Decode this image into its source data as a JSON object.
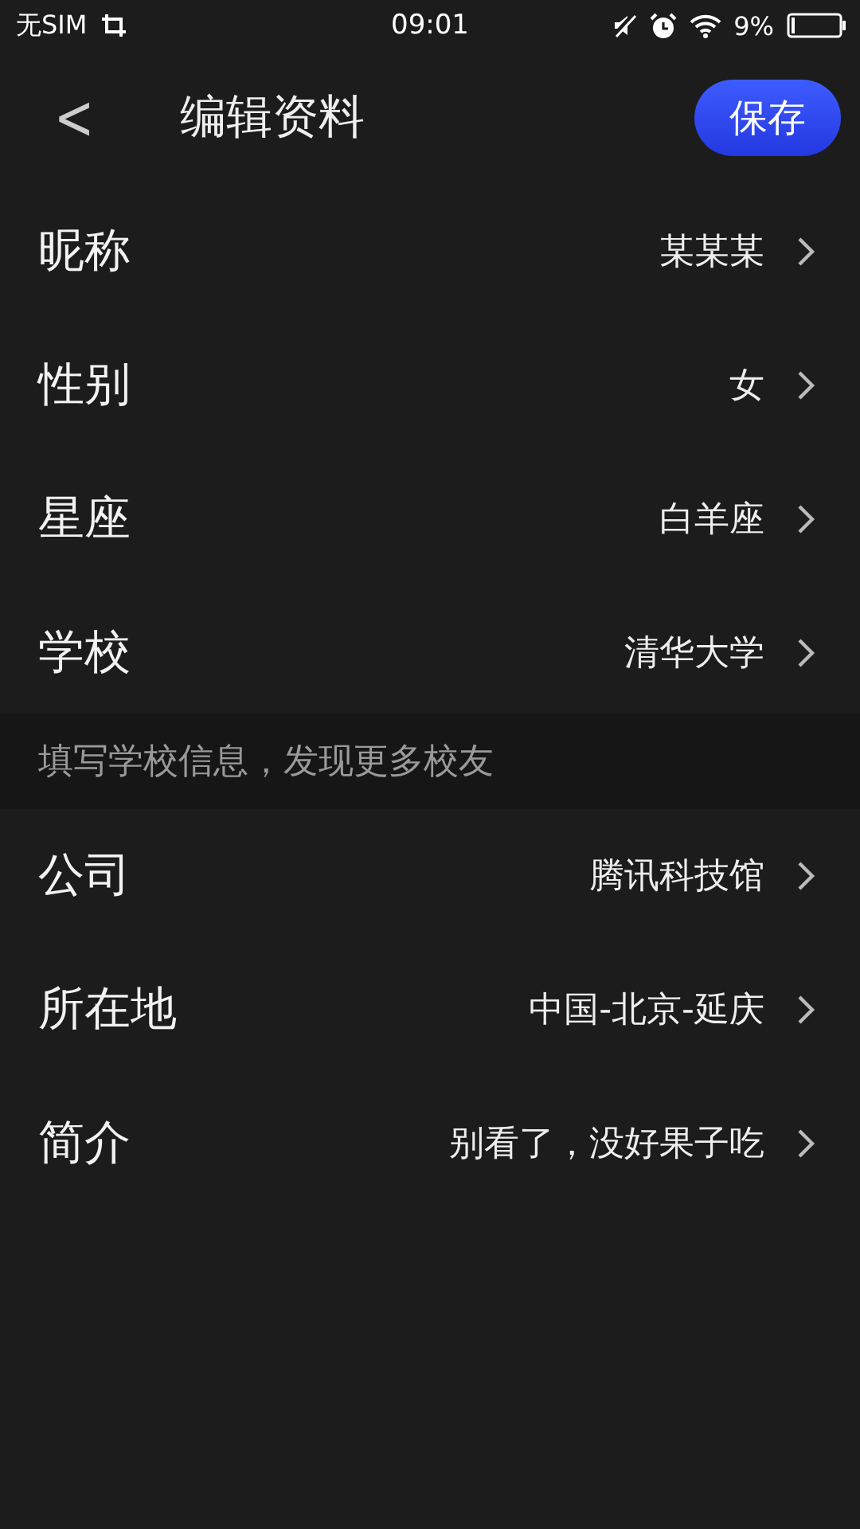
{
  "status_bar": {
    "carrier": "无SIM",
    "time": "09:01",
    "battery_text": "9%"
  },
  "header": {
    "back": "<",
    "title": "编辑资料",
    "save_button": "保存"
  },
  "items": [
    {
      "kind": "row",
      "label": "昵称",
      "value": "某某某"
    },
    {
      "kind": "row",
      "label": "性别",
      "value": "女"
    },
    {
      "kind": "row",
      "label": "星座",
      "value": "白羊座"
    },
    {
      "kind": "row",
      "label": "学校",
      "value": "清华大学"
    },
    {
      "kind": "hint",
      "text": "填写学校信息，发现更多校友"
    },
    {
      "kind": "row",
      "label": "公司",
      "value": "腾讯科技馆"
    },
    {
      "kind": "row",
      "label": "所在地",
      "value": "中国-北京-延庆"
    },
    {
      "kind": "row",
      "label": "简介",
      "value": "别看了，没好果子吃"
    }
  ]
}
